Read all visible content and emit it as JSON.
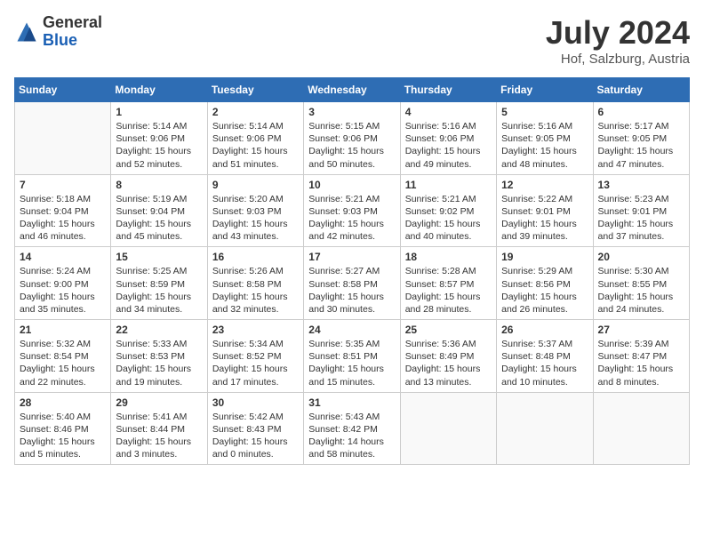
{
  "header": {
    "logo": {
      "general": "General",
      "blue": "Blue"
    },
    "title": "July 2024",
    "location": "Hof, Salzburg, Austria"
  },
  "calendar": {
    "days_of_week": [
      "Sunday",
      "Monday",
      "Tuesday",
      "Wednesday",
      "Thursday",
      "Friday",
      "Saturday"
    ],
    "weeks": [
      [
        {
          "day": "",
          "info": ""
        },
        {
          "day": "1",
          "info": "Sunrise: 5:14 AM\nSunset: 9:06 PM\nDaylight: 15 hours\nand 52 minutes."
        },
        {
          "day": "2",
          "info": "Sunrise: 5:14 AM\nSunset: 9:06 PM\nDaylight: 15 hours\nand 51 minutes."
        },
        {
          "day": "3",
          "info": "Sunrise: 5:15 AM\nSunset: 9:06 PM\nDaylight: 15 hours\nand 50 minutes."
        },
        {
          "day": "4",
          "info": "Sunrise: 5:16 AM\nSunset: 9:06 PM\nDaylight: 15 hours\nand 49 minutes."
        },
        {
          "day": "5",
          "info": "Sunrise: 5:16 AM\nSunset: 9:05 PM\nDaylight: 15 hours\nand 48 minutes."
        },
        {
          "day": "6",
          "info": "Sunrise: 5:17 AM\nSunset: 9:05 PM\nDaylight: 15 hours\nand 47 minutes."
        }
      ],
      [
        {
          "day": "7",
          "info": "Sunrise: 5:18 AM\nSunset: 9:04 PM\nDaylight: 15 hours\nand 46 minutes."
        },
        {
          "day": "8",
          "info": "Sunrise: 5:19 AM\nSunset: 9:04 PM\nDaylight: 15 hours\nand 45 minutes."
        },
        {
          "day": "9",
          "info": "Sunrise: 5:20 AM\nSunset: 9:03 PM\nDaylight: 15 hours\nand 43 minutes."
        },
        {
          "day": "10",
          "info": "Sunrise: 5:21 AM\nSunset: 9:03 PM\nDaylight: 15 hours\nand 42 minutes."
        },
        {
          "day": "11",
          "info": "Sunrise: 5:21 AM\nSunset: 9:02 PM\nDaylight: 15 hours\nand 40 minutes."
        },
        {
          "day": "12",
          "info": "Sunrise: 5:22 AM\nSunset: 9:01 PM\nDaylight: 15 hours\nand 39 minutes."
        },
        {
          "day": "13",
          "info": "Sunrise: 5:23 AM\nSunset: 9:01 PM\nDaylight: 15 hours\nand 37 minutes."
        }
      ],
      [
        {
          "day": "14",
          "info": "Sunrise: 5:24 AM\nSunset: 9:00 PM\nDaylight: 15 hours\nand 35 minutes."
        },
        {
          "day": "15",
          "info": "Sunrise: 5:25 AM\nSunset: 8:59 PM\nDaylight: 15 hours\nand 34 minutes."
        },
        {
          "day": "16",
          "info": "Sunrise: 5:26 AM\nSunset: 8:58 PM\nDaylight: 15 hours\nand 32 minutes."
        },
        {
          "day": "17",
          "info": "Sunrise: 5:27 AM\nSunset: 8:58 PM\nDaylight: 15 hours\nand 30 minutes."
        },
        {
          "day": "18",
          "info": "Sunrise: 5:28 AM\nSunset: 8:57 PM\nDaylight: 15 hours\nand 28 minutes."
        },
        {
          "day": "19",
          "info": "Sunrise: 5:29 AM\nSunset: 8:56 PM\nDaylight: 15 hours\nand 26 minutes."
        },
        {
          "day": "20",
          "info": "Sunrise: 5:30 AM\nSunset: 8:55 PM\nDaylight: 15 hours\nand 24 minutes."
        }
      ],
      [
        {
          "day": "21",
          "info": "Sunrise: 5:32 AM\nSunset: 8:54 PM\nDaylight: 15 hours\nand 22 minutes."
        },
        {
          "day": "22",
          "info": "Sunrise: 5:33 AM\nSunset: 8:53 PM\nDaylight: 15 hours\nand 19 minutes."
        },
        {
          "day": "23",
          "info": "Sunrise: 5:34 AM\nSunset: 8:52 PM\nDaylight: 15 hours\nand 17 minutes."
        },
        {
          "day": "24",
          "info": "Sunrise: 5:35 AM\nSunset: 8:51 PM\nDaylight: 15 hours\nand 15 minutes."
        },
        {
          "day": "25",
          "info": "Sunrise: 5:36 AM\nSunset: 8:49 PM\nDaylight: 15 hours\nand 13 minutes."
        },
        {
          "day": "26",
          "info": "Sunrise: 5:37 AM\nSunset: 8:48 PM\nDaylight: 15 hours\nand 10 minutes."
        },
        {
          "day": "27",
          "info": "Sunrise: 5:39 AM\nSunset: 8:47 PM\nDaylight: 15 hours\nand 8 minutes."
        }
      ],
      [
        {
          "day": "28",
          "info": "Sunrise: 5:40 AM\nSunset: 8:46 PM\nDaylight: 15 hours\nand 5 minutes."
        },
        {
          "day": "29",
          "info": "Sunrise: 5:41 AM\nSunset: 8:44 PM\nDaylight: 15 hours\nand 3 minutes."
        },
        {
          "day": "30",
          "info": "Sunrise: 5:42 AM\nSunset: 8:43 PM\nDaylight: 15 hours\nand 0 minutes."
        },
        {
          "day": "31",
          "info": "Sunrise: 5:43 AM\nSunset: 8:42 PM\nDaylight: 14 hours\nand 58 minutes."
        },
        {
          "day": "",
          "info": ""
        },
        {
          "day": "",
          "info": ""
        },
        {
          "day": "",
          "info": ""
        }
      ]
    ]
  }
}
